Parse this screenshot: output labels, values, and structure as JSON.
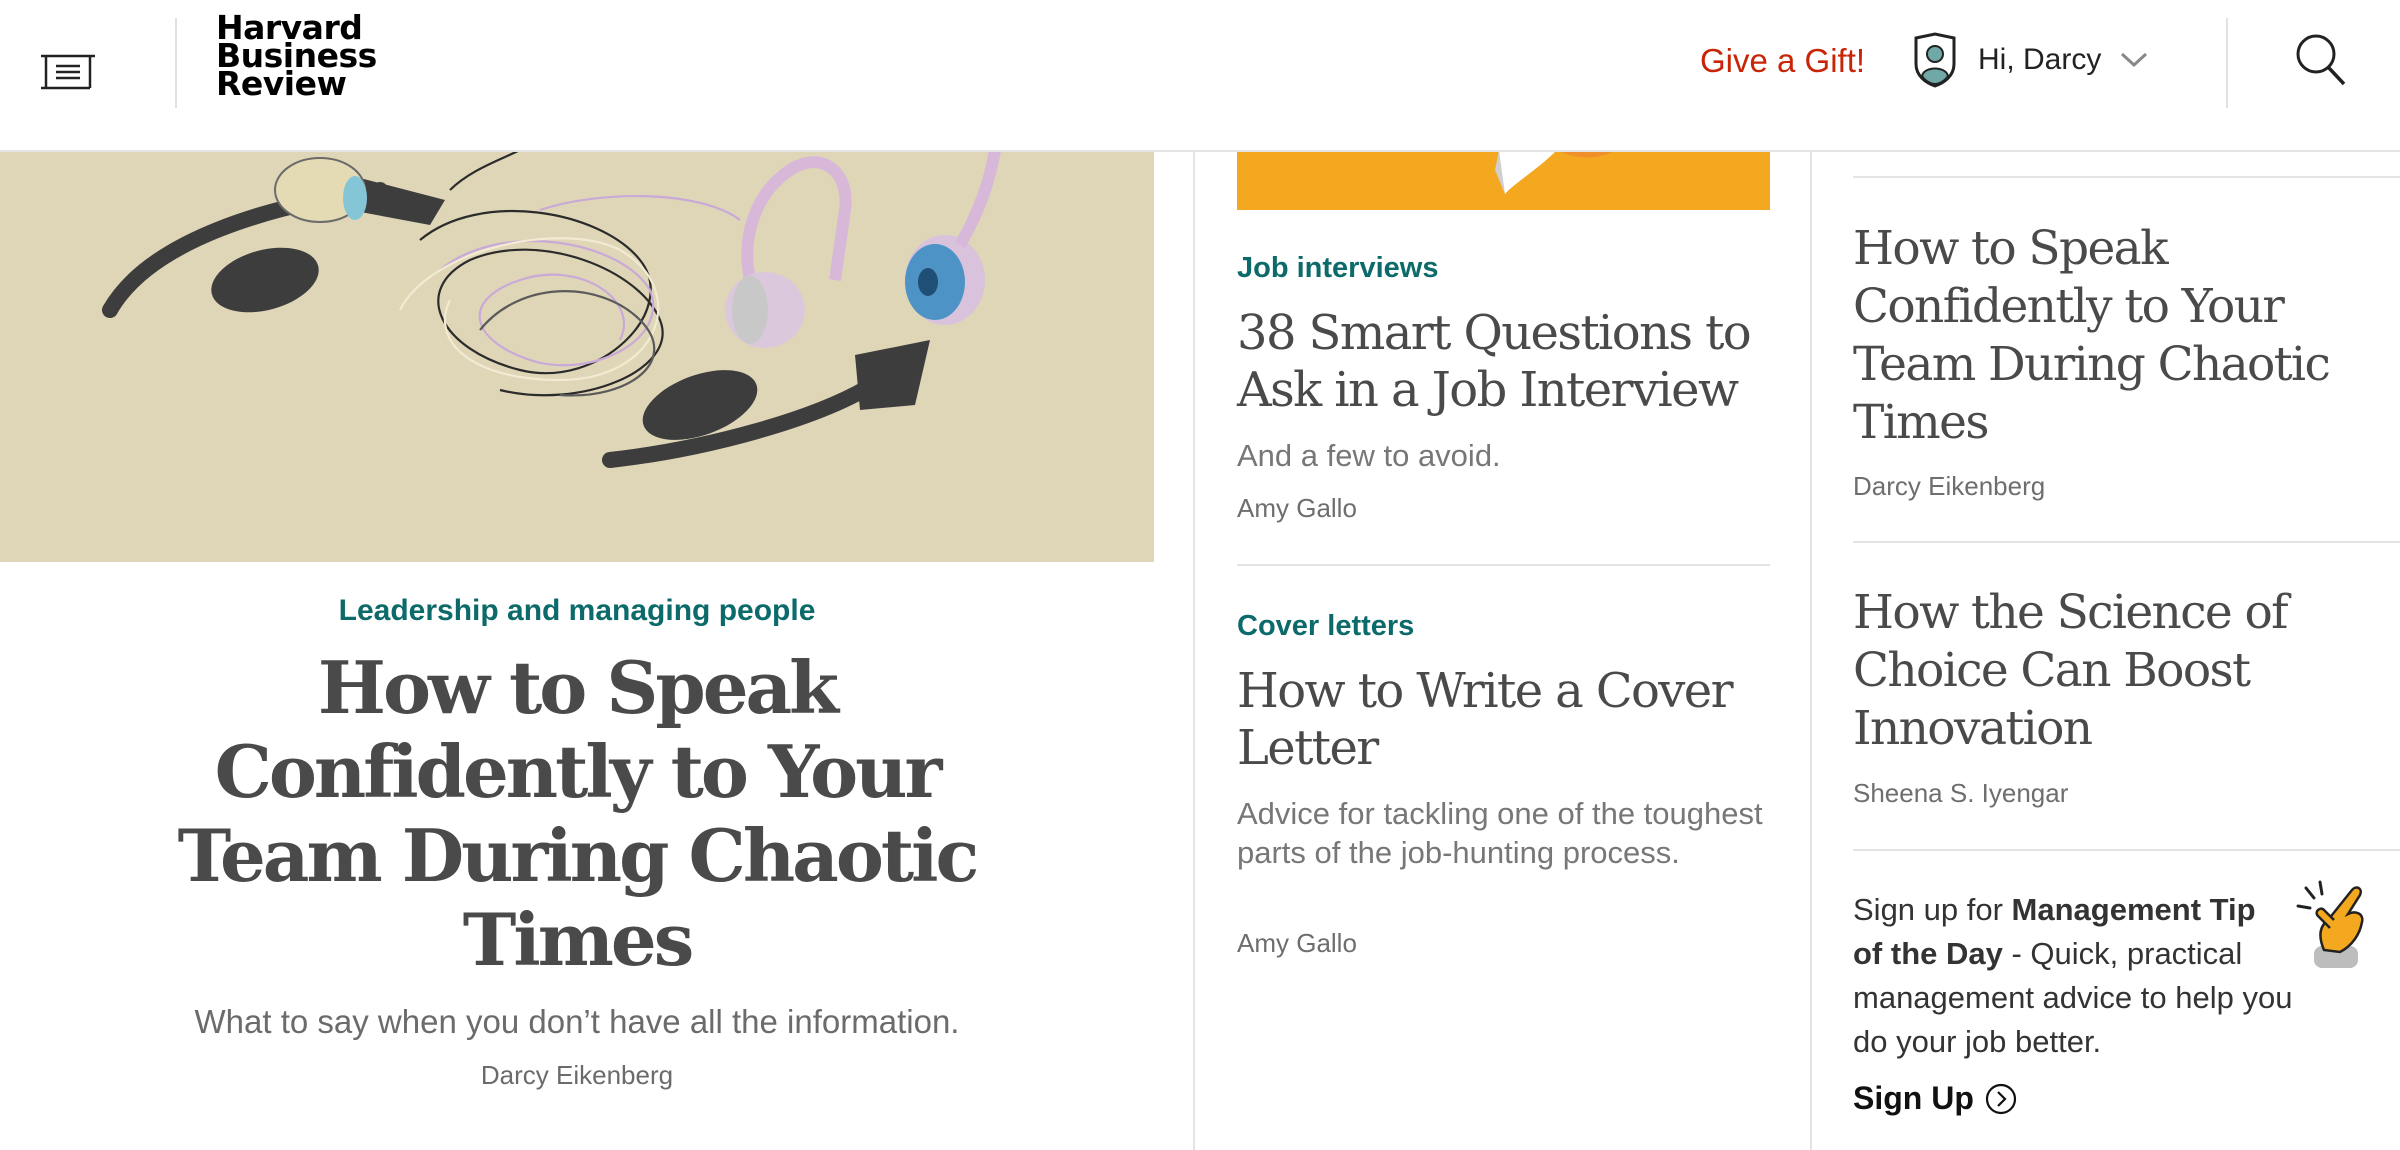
{
  "header": {
    "logo_lines": [
      "Harvard",
      "Business",
      "Review"
    ],
    "gift_label": "Give a Gift!",
    "user_greeting": "Hi, Darcy",
    "colors": {
      "gift": "#c82506"
    },
    "icons": [
      "menu-icon",
      "user-avatar-icon",
      "chevron-down-icon",
      "search-icon"
    ]
  },
  "hero": {
    "kicker": "Leadership and managing people",
    "title": "How to Speak Confidently to Your Team During Chaotic Times",
    "dek": "What to say when you don’t have all the information.",
    "author": "Darcy Eikenberg"
  },
  "middle": {
    "articles": [
      {
        "kicker": "Job interviews",
        "title": "38 Smart Questions to Ask in a Job Interview",
        "dek": "And a few to avoid.",
        "author": "Amy Gallo"
      },
      {
        "kicker": "Cover letters",
        "title": "How to Write a Cover Letter",
        "dek": "Advice for tackling one of the toughest parts of the job-hunting process.",
        "author": "Amy Gallo"
      }
    ]
  },
  "right": {
    "articles": [
      {
        "title": "How to Speak Confidently to Your Team During Chaotic Times",
        "author": "Darcy Eikenberg"
      },
      {
        "title": "How the Science of Choice Can Boost Innovation",
        "author": "Sheena S. Iyengar"
      }
    ],
    "promo": {
      "prefix": "Sign up for ",
      "strong": "Management Tip of the Day",
      "suffix": " - Quick, practical management advice to help you do your job better.",
      "cta": "Sign Up"
    }
  },
  "colors": {
    "kicker": "#0c6b6a",
    "accent_orange": "#f4a81f"
  }
}
